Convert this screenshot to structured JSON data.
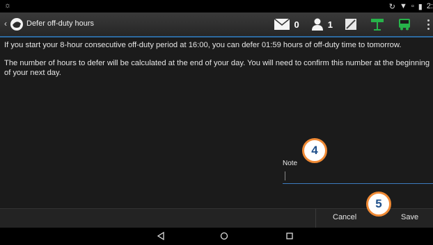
{
  "app_bar": {
    "title": "Defer off-duty hours",
    "messages_count": "0",
    "users_count": "1"
  },
  "content": {
    "paragraph_1": "If you start your 8-hour consecutive off-duty period at 16:00, you can defer 01:59 hours of off-duty time to tomorrow.",
    "paragraph_2": "The number of hours to defer will be calculated at the end of your day. You will need to confirm this number at the beginning of your next day."
  },
  "note": {
    "label": "Note",
    "value": ""
  },
  "actions": {
    "cancel_label": "Cancel",
    "save_label": "Save"
  },
  "badges": {
    "note_step": "4",
    "save_step": "5"
  },
  "colors": {
    "accent": "#3d7cc0",
    "badge_border": "#f08a35",
    "badge_text": "#1f4f8a",
    "green_icon": "#27b34a"
  }
}
